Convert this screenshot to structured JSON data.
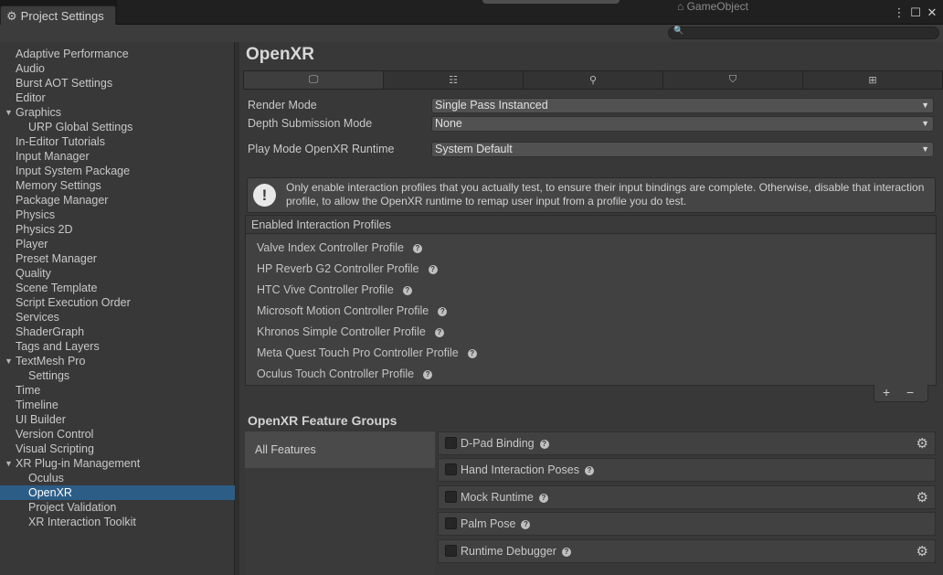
{
  "window": {
    "tab_title": "Project Settings",
    "background_object_label": "GameObject",
    "icons": [
      "kebab-menu-icon",
      "maximize-icon",
      "close-icon"
    ]
  },
  "search": {
    "placeholder": ""
  },
  "sidebar": {
    "items": [
      {
        "label": "Adaptive Performance",
        "indent": 0
      },
      {
        "label": "Audio",
        "indent": 0
      },
      {
        "label": "Burst AOT Settings",
        "indent": 0
      },
      {
        "label": "Editor",
        "indent": 0
      },
      {
        "label": "Graphics",
        "indent": 0,
        "expanded": true
      },
      {
        "label": "URP Global Settings",
        "indent": 1
      },
      {
        "label": "In-Editor Tutorials",
        "indent": 0
      },
      {
        "label": "Input Manager",
        "indent": 0
      },
      {
        "label": "Input System Package",
        "indent": 0
      },
      {
        "label": "Memory Settings",
        "indent": 0
      },
      {
        "label": "Package Manager",
        "indent": 0
      },
      {
        "label": "Physics",
        "indent": 0
      },
      {
        "label": "Physics 2D",
        "indent": 0
      },
      {
        "label": "Player",
        "indent": 0
      },
      {
        "label": "Preset Manager",
        "indent": 0
      },
      {
        "label": "Quality",
        "indent": 0
      },
      {
        "label": "Scene Template",
        "indent": 0
      },
      {
        "label": "Script Execution Order",
        "indent": 0
      },
      {
        "label": "Services",
        "indent": 0
      },
      {
        "label": "ShaderGraph",
        "indent": 0
      },
      {
        "label": "Tags and Layers",
        "indent": 0
      },
      {
        "label": "TextMesh Pro",
        "indent": 0,
        "expanded": true
      },
      {
        "label": "Settings",
        "indent": 1
      },
      {
        "label": "Time",
        "indent": 0
      },
      {
        "label": "Timeline",
        "indent": 0
      },
      {
        "label": "UI Builder",
        "indent": 0
      },
      {
        "label": "Version Control",
        "indent": 0
      },
      {
        "label": "Visual Scripting",
        "indent": 0
      },
      {
        "label": "XR Plug-in Management",
        "indent": 0,
        "expanded": true
      },
      {
        "label": "Oculus",
        "indent": 1
      },
      {
        "label": "OpenXR",
        "indent": 1,
        "selected": true
      },
      {
        "label": "Project Validation",
        "indent": 1
      },
      {
        "label": "XR Interaction Toolkit",
        "indent": 1
      }
    ]
  },
  "main": {
    "title": "OpenXR",
    "platform_tabs": [
      {
        "icon": "desktop-icon",
        "active": true
      },
      {
        "icon": "server-icon",
        "active": false
      },
      {
        "icon": "android-icon",
        "active": false
      },
      {
        "icon": "html5-icon",
        "active": false
      },
      {
        "icon": "windows-icon",
        "active": false
      }
    ],
    "settings": [
      {
        "label": "Render Mode",
        "value": "Single Pass Instanced"
      },
      {
        "label": "Depth Submission Mode",
        "value": "None"
      },
      {
        "label": "Play Mode OpenXR Runtime",
        "value": "System Default"
      }
    ],
    "help_message": "Only enable interaction profiles that you actually test, to ensure their input bindings are complete. Otherwise, disable that interaction profile, to allow the OpenXR runtime to remap user input from a profile you do test.",
    "profiles": {
      "header": "Enabled Interaction Profiles",
      "items": [
        "Valve Index Controller Profile",
        "HP Reverb G2 Controller Profile",
        "HTC Vive Controller Profile",
        "Microsoft Motion Controller Profile",
        "Khronos Simple Controller Profile",
        "Meta Quest Touch Pro Controller Profile",
        "Oculus Touch Controller Profile"
      ],
      "add_label": "+",
      "remove_label": "−"
    },
    "feature_groups": {
      "title": "OpenXR Feature Groups",
      "groups": [
        "All Features"
      ],
      "features": [
        {
          "name": "D-Pad Binding",
          "checked": false,
          "has_settings": true
        },
        {
          "name": "Hand Interaction Poses",
          "checked": false,
          "has_settings": false
        },
        {
          "name": "Mock Runtime",
          "checked": false,
          "has_settings": true
        },
        {
          "name": "Palm Pose",
          "checked": false,
          "has_settings": false
        },
        {
          "name": "Runtime Debugger",
          "checked": false,
          "has_settings": true
        }
      ]
    }
  }
}
